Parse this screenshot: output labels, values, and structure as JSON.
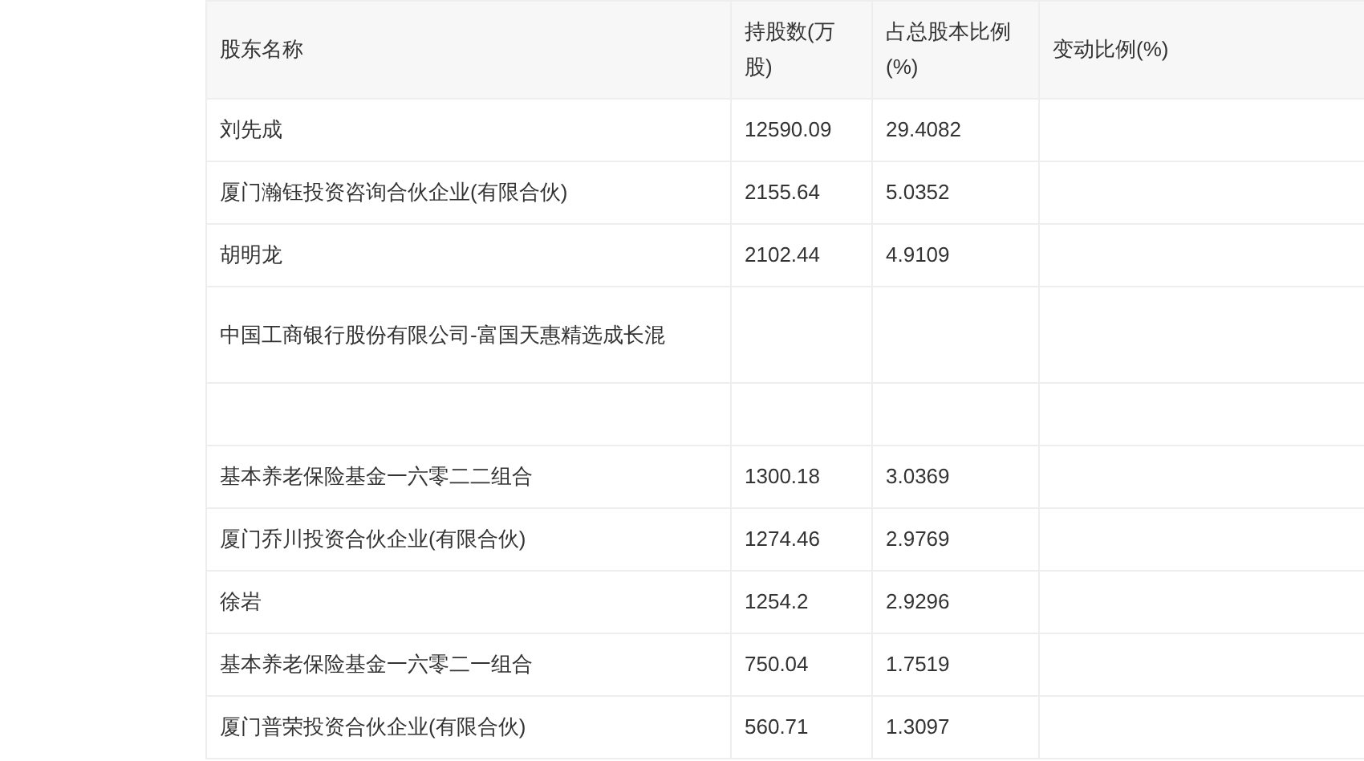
{
  "table": {
    "columns": [
      "股东名称",
      "持股数(万股)",
      "占总股本比例(%)",
      "变动比例(%)"
    ],
    "rows": [
      {
        "name": "刘先成",
        "shares": "12590.09",
        "ratio": "29.4082"
      },
      {
        "name": "厦门瀚钰投资咨询合伙企业(有限合伙)",
        "shares": "2155.64",
        "ratio": "5.0352"
      },
      {
        "name": "胡明龙",
        "shares": "2102.44",
        "ratio": "4.9109"
      },
      {
        "name": "中国工商银行股份有限公司-富国天惠精选成长混"
      },
      {},
      {
        "name": "基本养老保险基金一六零二二组合",
        "shares": "1300.18",
        "ratio": "3.0369"
      },
      {
        "name": "厦门乔川投资合伙企业(有限合伙)",
        "shares": "1274.46",
        "ratio": "2.9769"
      },
      {
        "name": "徐岩",
        "shares": "1254.2",
        "ratio": "2.9296"
      },
      {
        "name": "基本养老保险基金一六零二一组合",
        "shares": "750.04",
        "ratio": "1.7519"
      },
      {
        "name": "厦门普荣投资合伙企业(有限合伙)",
        "shares": "560.71",
        "ratio": "1.3097"
      }
    ]
  }
}
